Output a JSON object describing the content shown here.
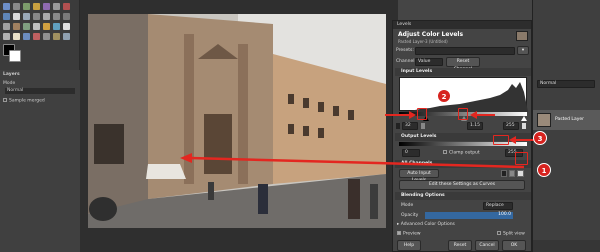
{
  "toolbox": {
    "layers_tab": "Layers",
    "mode_label": "Mode",
    "mode_value": "Normal",
    "sample_merged": "Sample merged"
  },
  "dialog": {
    "window_title": "Levels",
    "header_title": "Adjust Color Levels",
    "header_subtitle": "Pasted Layer-3 (Untitled)",
    "presets_label": "Presets:",
    "channel_label": "Channel:",
    "channel_value": "Value",
    "reset_channel": "Reset Channel",
    "input_levels": "Input Levels",
    "input_low": "32",
    "gamma_value": "1.15",
    "input_high": "255",
    "output_levels": "Output Levels",
    "output_low": "0",
    "clamp_output": "Clamp output",
    "output_high": "255",
    "all_channels": "All Channels",
    "auto_input": "Auto Input Levels",
    "edit_curves": "Edit these Settings as Curves",
    "blending_options": "Blending Options",
    "blend_mode_label": "Mode",
    "blend_mode_value": "Replace",
    "opacity_label": "Opacity",
    "opacity_value": "100.0",
    "advanced_color": "Advanced Color Options",
    "preview": "Preview",
    "split_view": "Split view",
    "help": "Help",
    "reset": "Reset",
    "cancel": "Cancel",
    "ok": "OK"
  },
  "layers_panel": {
    "mode_value": "Normal",
    "layer_name": "Pasted Layer"
  },
  "callouts": {
    "one": "1",
    "two": "2",
    "three": "3"
  },
  "accent_color": "#e32720"
}
